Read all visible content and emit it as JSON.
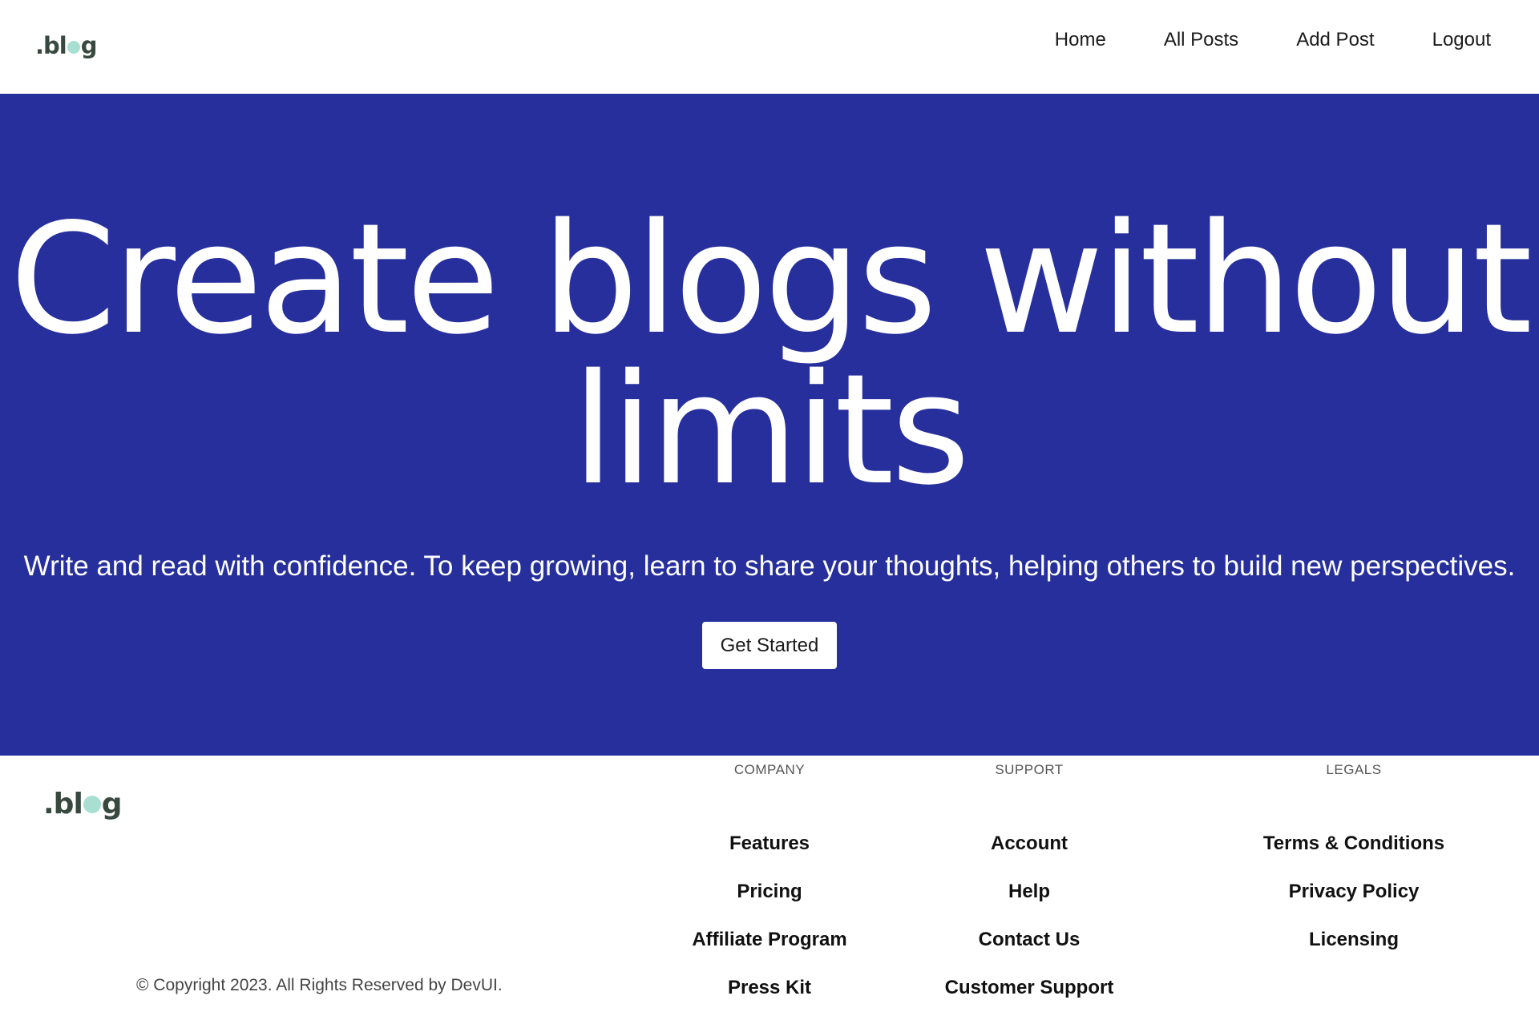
{
  "navbar": {
    "logo": {
      "pre": ".bl",
      "post": "g"
    },
    "links": [
      "Home",
      "All Posts",
      "Add Post",
      "Logout"
    ]
  },
  "hero": {
    "title": "Create blogs without limits",
    "subtitle": "Write and read with confidence. To keep growing, learn to share your thoughts, helping others to build new perspectives.",
    "cta_label": "Get Started"
  },
  "footer": {
    "logo": {
      "pre": ".bl",
      "post": "g"
    },
    "columns": [
      {
        "heading": "COMPANY",
        "links": [
          "Features",
          "Pricing",
          "Affiliate Program",
          "Press Kit"
        ]
      },
      {
        "heading": "SUPPORT",
        "links": [
          "Account",
          "Help",
          "Contact Us",
          "Customer Support"
        ]
      },
      {
        "heading": "LEGALS",
        "links": [
          "Terms & Conditions",
          "Privacy Policy",
          "Licensing"
        ]
      }
    ],
    "copyright": "© Copyright 2023. All Rights Reserved by DevUI."
  },
  "colors": {
    "hero_background": "#262f9c",
    "logo_text": "#384a3f",
    "logo_accent": "#a8dfd1"
  }
}
